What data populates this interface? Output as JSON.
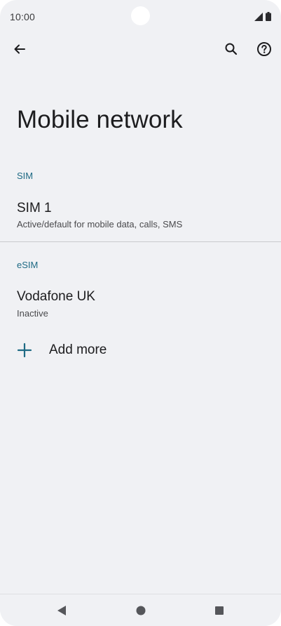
{
  "status_bar": {
    "time": "10:00",
    "icons": [
      "signal-icon",
      "battery-icon"
    ]
  },
  "app_bar": {
    "icons": [
      "back-arrow-icon",
      "search-icon",
      "help-icon"
    ]
  },
  "page": {
    "title": "Mobile network"
  },
  "sim_section": {
    "header": "SIM",
    "items": [
      {
        "title": "SIM 1",
        "subtitle": "Active/default for mobile data, calls, SMS"
      }
    ]
  },
  "esim_section": {
    "header": "eSIM",
    "items": [
      {
        "title": "Vodafone UK",
        "subtitle": "Inactive"
      }
    ],
    "add_more_label": "Add more"
  },
  "nav_bar": {
    "icons": [
      "nav-back-icon",
      "nav-home-icon",
      "nav-recents-icon"
    ]
  },
  "colors": {
    "background": "#f0f1f4",
    "accent": "#1e6a84",
    "text_primary": "#1c1c1e",
    "text_secondary": "#4a4a4d",
    "divider": "#c9cacd"
  }
}
